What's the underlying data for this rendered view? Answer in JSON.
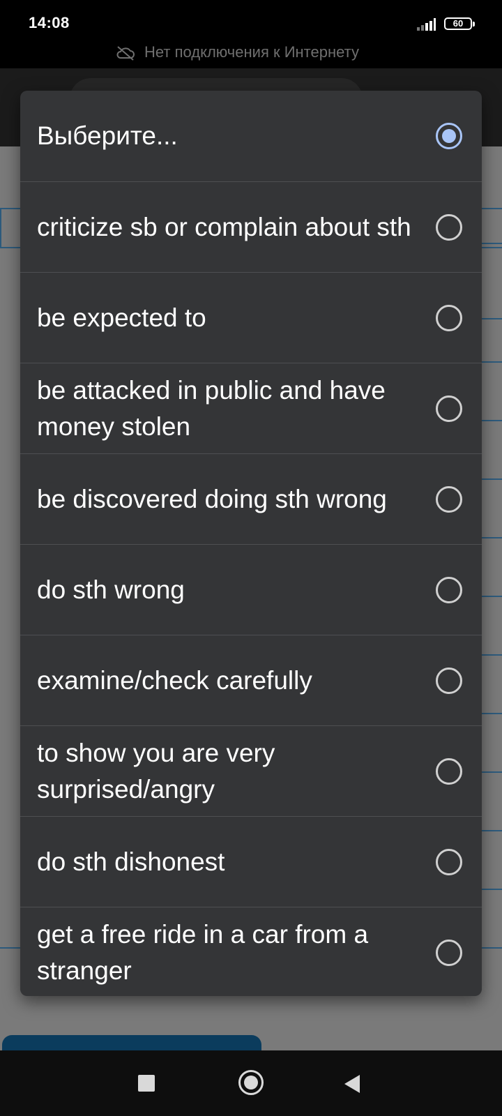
{
  "status_bar": {
    "time": "14:08",
    "battery": "60",
    "icons": [
      "signal-icon",
      "battery-icon"
    ]
  },
  "offline_banner": {
    "icon": "cloud-off-icon",
    "text": "Нет подключения к Интернету"
  },
  "dialog": {
    "options": [
      {
        "label": "Выберите...",
        "selected": true
      },
      {
        "label": "criticize sb or complain about sth",
        "selected": false
      },
      {
        "label": "be expected to",
        "selected": false
      },
      {
        "label": "be attacked in public and have money stolen",
        "selected": false
      },
      {
        "label": "be discovered doing sth wrong",
        "selected": false
      },
      {
        "label": "do sth wrong",
        "selected": false
      },
      {
        "label": "examine/check carefully",
        "selected": false
      },
      {
        "label": "to show you are very surprised/angry",
        "selected": false
      },
      {
        "label": "do sth dishonest",
        "selected": false
      },
      {
        "label": "get a free ride in a car from a stranger",
        "selected": false
      }
    ]
  },
  "colors": {
    "dialog_bg": "#343537",
    "radio_selected": "#a9c5f7",
    "accent": "#0b3c5d"
  },
  "nav_bar": {
    "icons": [
      "recents-square-icon",
      "home-circle-icon",
      "back-triangle-icon"
    ]
  }
}
